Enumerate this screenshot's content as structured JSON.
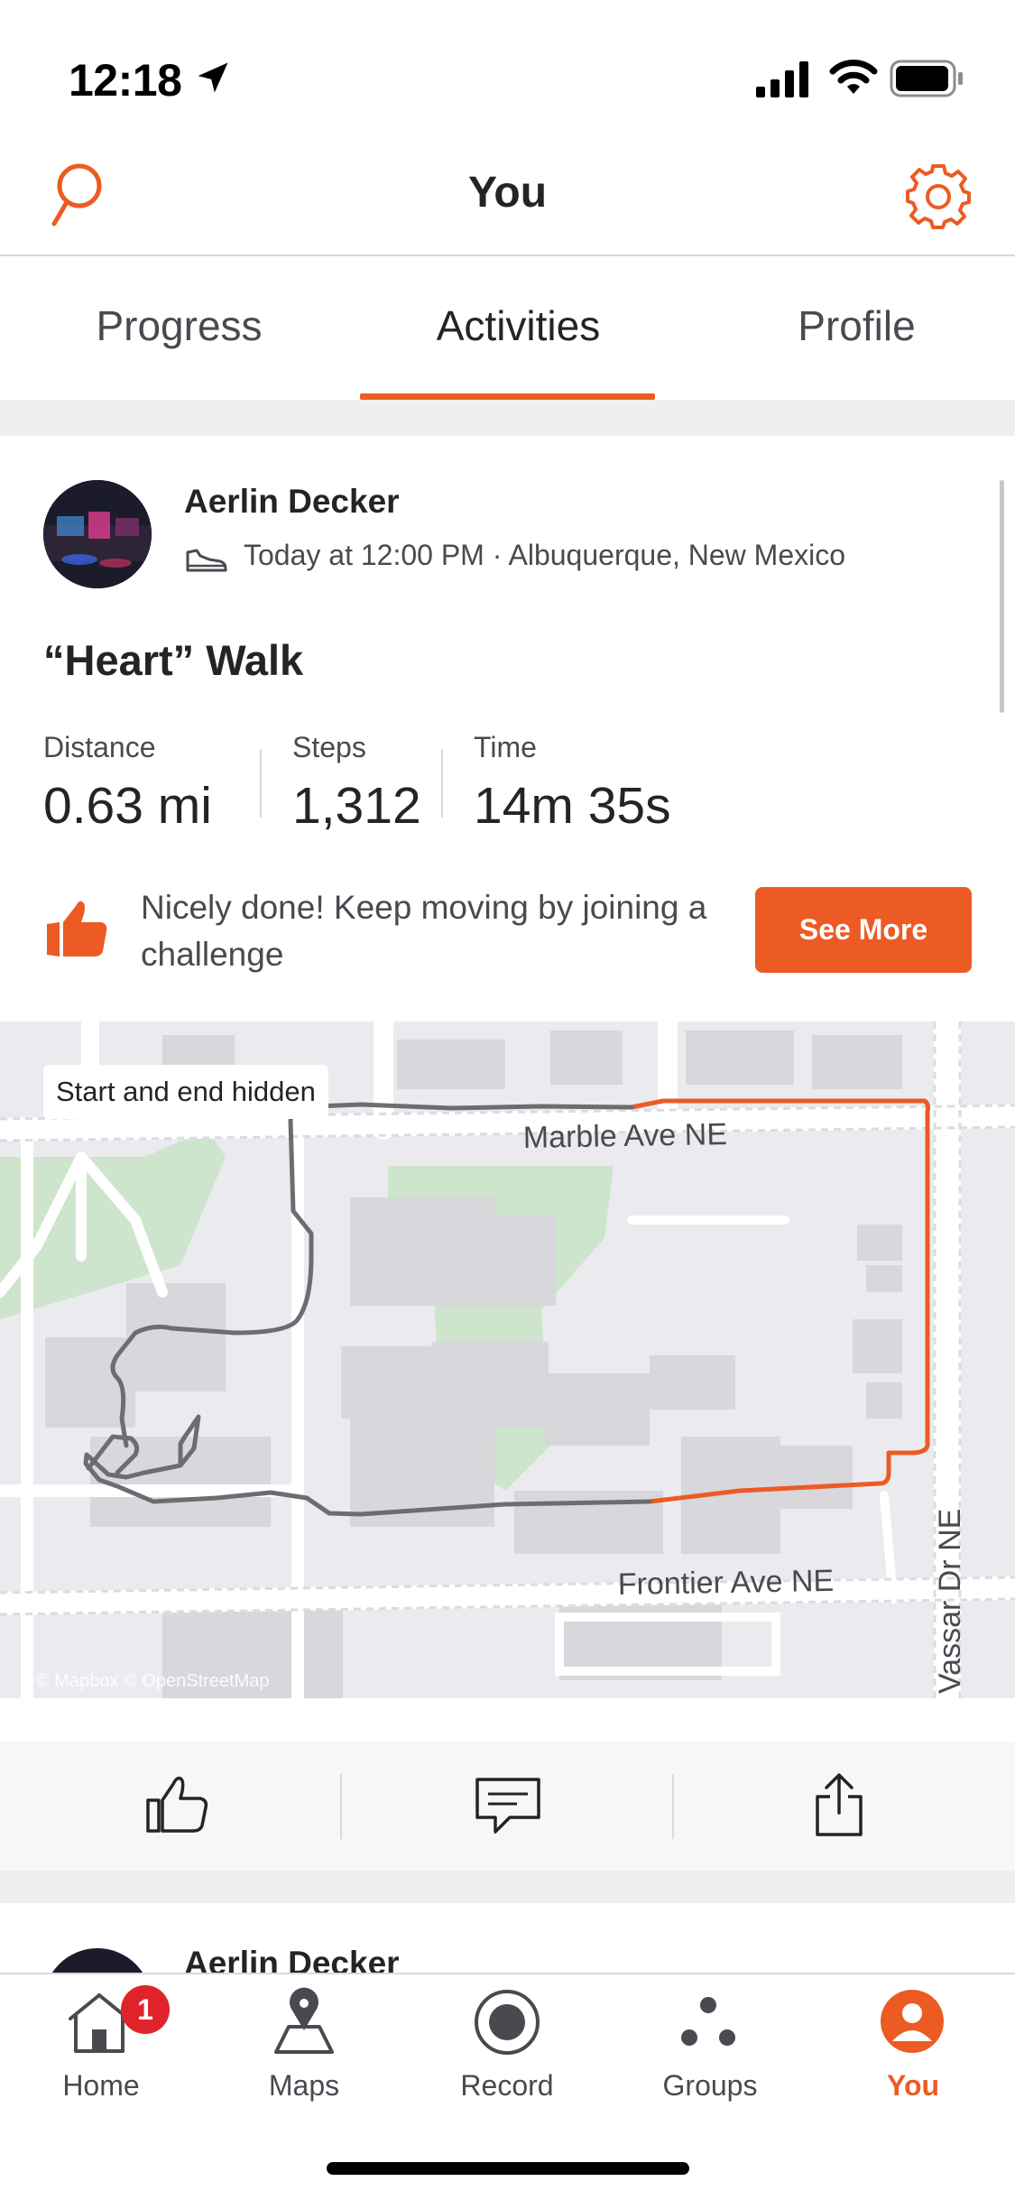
{
  "status": {
    "time": "12:18"
  },
  "header": {
    "title": "You"
  },
  "tabs": [
    {
      "label": "Progress",
      "selected": false
    },
    {
      "label": "Activities",
      "selected": true
    },
    {
      "label": "Profile",
      "selected": false
    }
  ],
  "activity": {
    "athlete": "Aerlin Decker",
    "meta": "Today at 12:00 PM · Albuquerque, New Mexico",
    "title": "“Heart” Walk",
    "stats": [
      {
        "label": "Distance",
        "value": "0.63 mi"
      },
      {
        "label": "Steps",
        "value": "1,312"
      },
      {
        "label": "Time",
        "value": "14m 35s"
      }
    ],
    "promo": "Nicely done! Keep moving by joining a challenge",
    "see_more": "See More",
    "map": {
      "badge": "Start and end hidden",
      "streets": [
        "Marble Ave NE",
        "Frontier Ave NE",
        "Vassar Dr NE"
      ],
      "attribution": "© Mapbox © OpenStreetMap"
    }
  },
  "next_activity": {
    "athlete": "Aerlin Decker"
  },
  "tabbar": {
    "items": [
      {
        "label": "Home",
        "badge": "1",
        "active": false
      },
      {
        "label": "Maps",
        "active": false
      },
      {
        "label": "Record",
        "active": false
      },
      {
        "label": "Groups",
        "active": false
      },
      {
        "label": "You",
        "active": true
      }
    ]
  },
  "colors": {
    "accent": "#ec5b24",
    "text": "#242428",
    "muted": "#494950",
    "badge": "#e0232a"
  }
}
